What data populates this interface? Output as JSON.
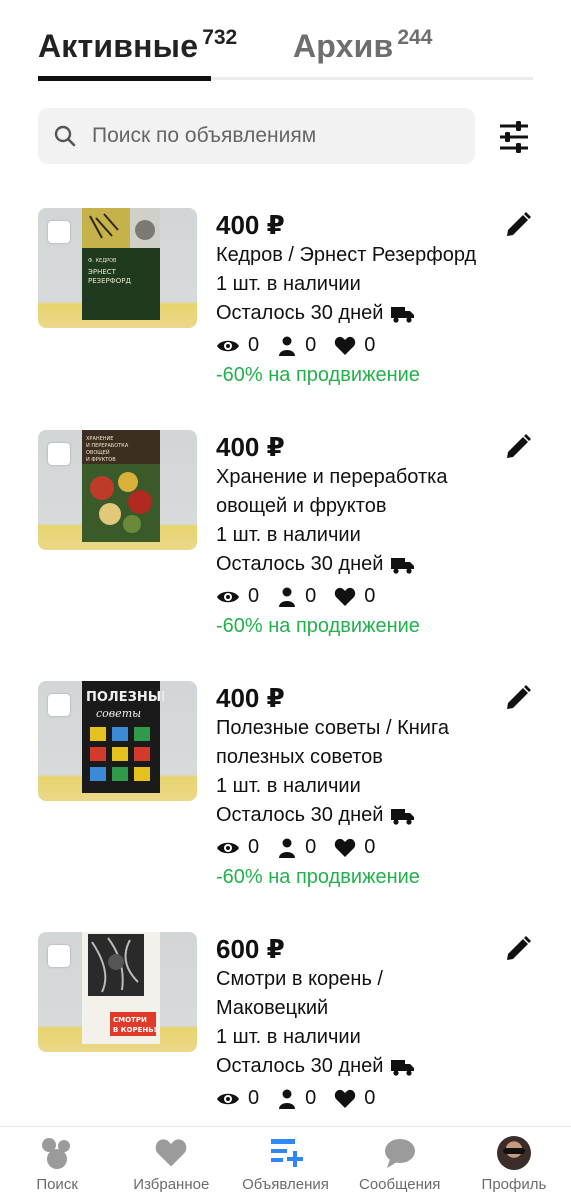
{
  "tabs": {
    "active": {
      "label": "Активные",
      "count": "732"
    },
    "archive": {
      "label": "Архив",
      "count": "244"
    }
  },
  "search": {
    "placeholder": "Поиск по объявлениям"
  },
  "listings": [
    {
      "price": "400 ₽",
      "title_lines": [
        "Кедров / Эрнест Резерфорд"
      ],
      "stock": "1 шт. в наличии",
      "days_left": "Осталось 30 дней",
      "views": "0",
      "contacts": "0",
      "favorites": "0",
      "promo": "-60% на продвижение"
    },
    {
      "price": "400 ₽",
      "title_lines": [
        "Хранение и переработка",
        "овощей и фруктов"
      ],
      "stock": "1 шт. в наличии",
      "days_left": "Осталось 30 дней",
      "views": "0",
      "contacts": "0",
      "favorites": "0",
      "promo": "-60% на продвижение"
    },
    {
      "price": "400 ₽",
      "title_lines": [
        "Полезные советы / Книга",
        "полезных советов"
      ],
      "stock": "1 шт. в наличии",
      "days_left": "Осталось 30 дней",
      "views": "0",
      "contacts": "0",
      "favorites": "0",
      "promo": "-60% на продвижение"
    },
    {
      "price": "600 ₽",
      "title_lines": [
        "Смотри в корень /",
        "Маковецкий"
      ],
      "stock": "1 шт. в наличии",
      "days_left": "Осталось 30 дней",
      "views": "0",
      "contacts": "0",
      "favorites": "0"
    }
  ],
  "covers": {
    "book_1": {
      "lines": [
        "Ф. КЕДРОВ",
        "ЭРНЕСТ",
        "РЕЗЕРФОРД"
      ]
    },
    "book_2": {
      "lines": [
        "ХРАНЕНИЕ",
        "И ПЕРЕРАБОТКА",
        "ОВОЩЕЙ",
        "И ФРУКТОВ"
      ]
    },
    "book_3": {
      "lines": [
        "ПОЛЕЗНЫЕ",
        "советы"
      ]
    },
    "book_4": {
      "lines": [
        "СМОТРИ",
        "В КОРЕНЬ!"
      ]
    }
  },
  "nav": [
    {
      "label": "Поиск",
      "icon": "search-bubbles-icon"
    },
    {
      "label": "Избранное",
      "icon": "heart-icon"
    },
    {
      "label": "Объявления",
      "icon": "listings-add-icon",
      "active": true
    },
    {
      "label": "Сообщения",
      "icon": "chat-icon"
    },
    {
      "label": "Профиль",
      "icon": "avatar"
    }
  ],
  "colors": {
    "accent": "#2f86f6",
    "promo": "#22b24c",
    "text": "#111111",
    "muted": "#6b6b6b"
  }
}
